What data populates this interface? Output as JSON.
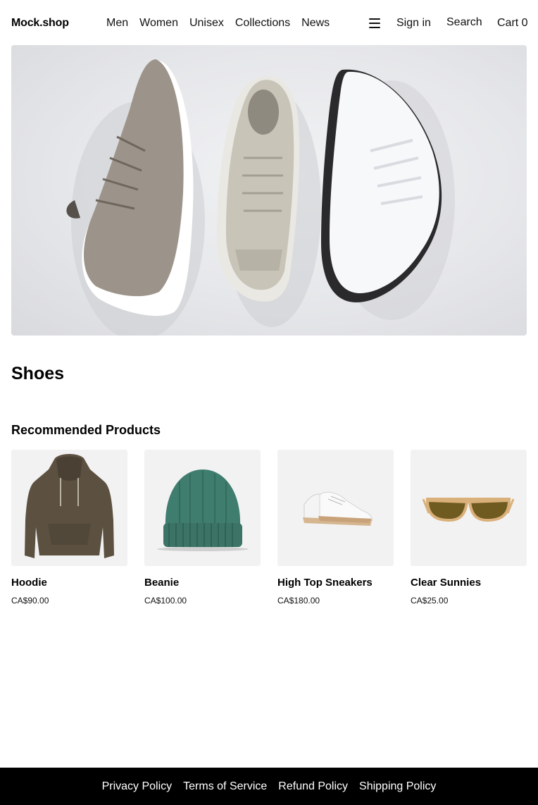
{
  "header": {
    "logo": "Mock.shop",
    "nav": [
      "Men",
      "Women",
      "Unisex",
      "Collections",
      "News"
    ],
    "menu_icon": "hamburger-icon",
    "sign_in": "Sign in",
    "search": "Search",
    "cart": "Cart 0"
  },
  "hero": {
    "image": "shoes-banner-image"
  },
  "page": {
    "title": "Shoes",
    "section_title": "Recommended Products"
  },
  "products": [
    {
      "name": "Hoodie",
      "price": "CA$90.00",
      "image": "hoodie-image"
    },
    {
      "name": "Beanie",
      "price": "CA$100.00",
      "image": "beanie-image"
    },
    {
      "name": "High Top Sneakers",
      "price": "CA$180.00",
      "image": "sneakers-image"
    },
    {
      "name": "Clear Sunnies",
      "price": "CA$25.00",
      "image": "sunglasses-image"
    }
  ],
  "footer": {
    "links": [
      "Privacy Policy",
      "Terms of Service",
      "Refund Policy",
      "Shipping Policy"
    ]
  },
  "colors": {
    "footer_bg": "#000000",
    "text": "#111111"
  }
}
